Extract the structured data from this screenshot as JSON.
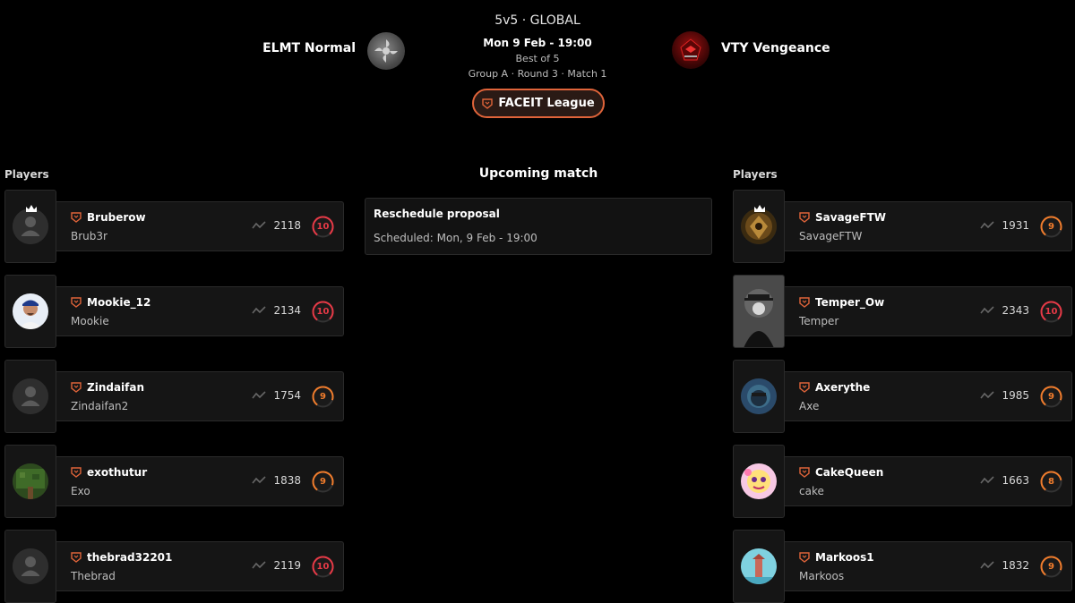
{
  "header": {
    "mode": "5v5 · GLOBAL",
    "date": "Mon 9 Feb - 19:00",
    "best_of": "Best of 5",
    "group_info": "Group A · Round 3 · Match 1",
    "league_label": "FACEIT League",
    "team_left": "ELMT Normal",
    "team_right": "VTY Vengeance"
  },
  "left_title": "Players",
  "right_title": "Players",
  "center": {
    "title": "Upcoming match",
    "card_title": "Reschedule proposal",
    "card_sub": "Scheduled: Mon, 9 Feb - 19:00"
  },
  "colors": {
    "accent": "#e0643a",
    "level10": "#e63946",
    "level9": "#f07c2c",
    "level8": "#f07c2c"
  },
  "left_players": [
    {
      "nick": "Bruberow",
      "name": "Brub3r",
      "elo": "2118",
      "level": "10",
      "captain": true,
      "avatar": "default"
    },
    {
      "nick": "Mookie_12",
      "name": "Mookie",
      "elo": "2134",
      "level": "10",
      "captain": false,
      "avatar": "photo"
    },
    {
      "nick": "Zindaifan",
      "name": "Zindaifan2",
      "elo": "1754",
      "level": "9",
      "captain": false,
      "avatar": "default"
    },
    {
      "nick": "exothutur",
      "name": "Exo",
      "elo": "1838",
      "level": "9",
      "captain": false,
      "avatar": "tree"
    },
    {
      "nick": "thebrad32201",
      "name": "Thebrad",
      "elo": "2119",
      "level": "10",
      "captain": false,
      "avatar": "default"
    }
  ],
  "right_players": [
    {
      "nick": "SavageFTW",
      "name": "SavageFTW",
      "elo": "1931",
      "level": "9",
      "captain": true,
      "avatar": "savage"
    },
    {
      "nick": "Temper_Ow",
      "name": "Temper",
      "elo": "2343",
      "level": "10",
      "captain": false,
      "avatar": "temper"
    },
    {
      "nick": "Axerythe",
      "name": "Axe",
      "elo": "1985",
      "level": "9",
      "captain": false,
      "avatar": "axe"
    },
    {
      "nick": "CakeQueen",
      "name": "cake",
      "elo": "1663",
      "level": "8",
      "captain": false,
      "avatar": "cake"
    },
    {
      "nick": "Markoos1",
      "name": "Markoos",
      "elo": "1832",
      "level": "9",
      "captain": false,
      "avatar": "markoos"
    }
  ]
}
